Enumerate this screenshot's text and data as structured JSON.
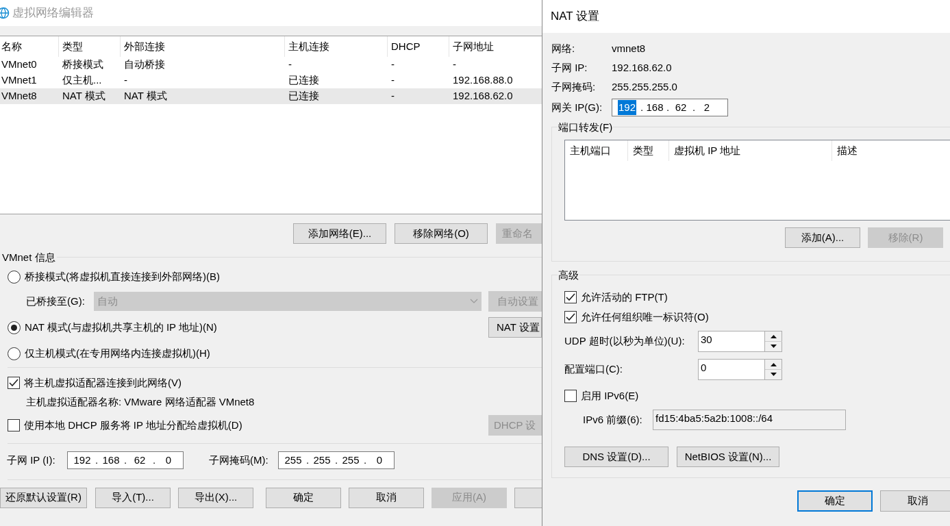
{
  "main_window": {
    "title": "虚拟网络编辑器",
    "table": {
      "columns": [
        "名称",
        "类型",
        "外部连接",
        "主机连接",
        "DHCP",
        "子网地址"
      ],
      "rows": [
        {
          "cells": [
            "VMnet0",
            "桥接模式",
            "自动桥接",
            "-",
            "-",
            "-"
          ],
          "selected": false
        },
        {
          "cells": [
            "VMnet1",
            "仅主机...",
            "-",
            "已连接",
            "-",
            "192.168.88.0"
          ],
          "selected": false
        },
        {
          "cells": [
            "VMnet8",
            "NAT 模式",
            "NAT 模式",
            "已连接",
            "-",
            "192.168.62.0"
          ],
          "selected": true
        }
      ]
    },
    "network_buttons": [
      {
        "label": "添加网络(E)...",
        "disabled": false
      },
      {
        "label": "移除网络(O)",
        "disabled": false
      },
      {
        "label": "重命名",
        "disabled": true
      }
    ],
    "vmnet_info": {
      "title": "VMnet 信息",
      "modes": [
        {
          "label": "桥接模式(将虚拟机直接连接到外部网络)(B)",
          "selected": false
        },
        {
          "label": "NAT 模式(与虚拟机共享主机的 IP 地址)(N)",
          "selected": true
        },
        {
          "label": "仅主机模式(在专用网络内连接虚拟机)(H)",
          "selected": false
        }
      ],
      "bridged_to": {
        "label": "已桥接至(G):",
        "value": "自动",
        "disabled": true
      },
      "auto_settings_button": {
        "label": "自动设置",
        "disabled": true
      },
      "nat_settings_button": {
        "label": "NAT 设置",
        "disabled": false
      },
      "connect_adapter": {
        "label": "将主机虚拟适配器连接到此网络(V)",
        "checked": true
      },
      "adapter_name": "主机虚拟适配器名称: VMware 网络适配器 VMnet8",
      "use_dhcp": {
        "label": "使用本地 DHCP 服务将 IP 地址分配给虚拟机(D)",
        "checked": false
      },
      "dhcp_settings_button": {
        "label": "DHCP 设",
        "disabled": true
      },
      "subnet_ip": {
        "label": "子网 IP (I):",
        "octets": [
          "192",
          "168",
          "62",
          "0"
        ],
        "separators": [
          ".",
          ".",
          "."
        ]
      },
      "subnet_mask": {
        "label": "子网掩码(M):",
        "octets": [
          "255",
          "255",
          "255",
          "0"
        ],
        "separators": [
          ".",
          ".",
          "."
        ]
      }
    },
    "footer_buttons": [
      {
        "label": "还原默认设置(R)",
        "disabled": false
      },
      {
        "label": "导入(T)...",
        "disabled": false
      },
      {
        "label": "导出(X)...",
        "disabled": false
      },
      {
        "label": "确定",
        "disabled": false
      },
      {
        "label": "取消",
        "disabled": false
      },
      {
        "label": "应用(A)",
        "disabled": true
      }
    ]
  },
  "nat_dialog": {
    "title": "NAT 设置",
    "info": [
      {
        "label": "网络:",
        "value": "vmnet8"
      },
      {
        "label": "子网 IP:",
        "value": "192.168.62.0"
      },
      {
        "label": "子网掩码:",
        "value": "255.255.255.0"
      }
    ],
    "gateway": {
      "label": "网关 IP(G):",
      "octets": [
        {
          "text": "192",
          "selected": true
        },
        {
          "text": "168",
          "selected": false
        },
        {
          "text": "62",
          "selected": false
        },
        {
          "text": "2",
          "selected": false
        }
      ],
      "separators": [
        ".",
        ".",
        "."
      ]
    },
    "port_forwarding": {
      "title": "端口转发(F)",
      "columns": [
        "主机端口",
        "类型",
        "虚拟机 IP 地址",
        "描述"
      ],
      "buttons": [
        {
          "label": "添加(A)...",
          "disabled": false
        },
        {
          "label": "移除(R)",
          "disabled": true
        }
      ]
    },
    "advanced": {
      "title": "高级",
      "allow_ftp": {
        "label": "允许活动的 FTP(T)",
        "checked": true
      },
      "allow_oui": {
        "label": "允许任何组织唯一标识符(O)",
        "checked": true
      },
      "udp_timeout": {
        "label": "UDP 超时(以秒为单位)(U):",
        "value": "30"
      },
      "config_port": {
        "label": "配置端口(C):",
        "value": "0"
      },
      "enable_ipv6": {
        "label": "启用 IPv6(E)",
        "checked": false
      },
      "ipv6_prefix": {
        "label": "IPv6 前缀(6):",
        "value": "fd15:4ba5:5a2b:1008::/64",
        "disabled": true
      },
      "buttons": [
        {
          "label": "DNS 设置(D)...",
          "disabled": false
        },
        {
          "label": "NetBIOS 设置(N)...",
          "disabled": false
        }
      ]
    },
    "buttons": [
      {
        "label": "确定",
        "focused": true
      },
      {
        "label": "取消",
        "focused": false
      }
    ]
  }
}
